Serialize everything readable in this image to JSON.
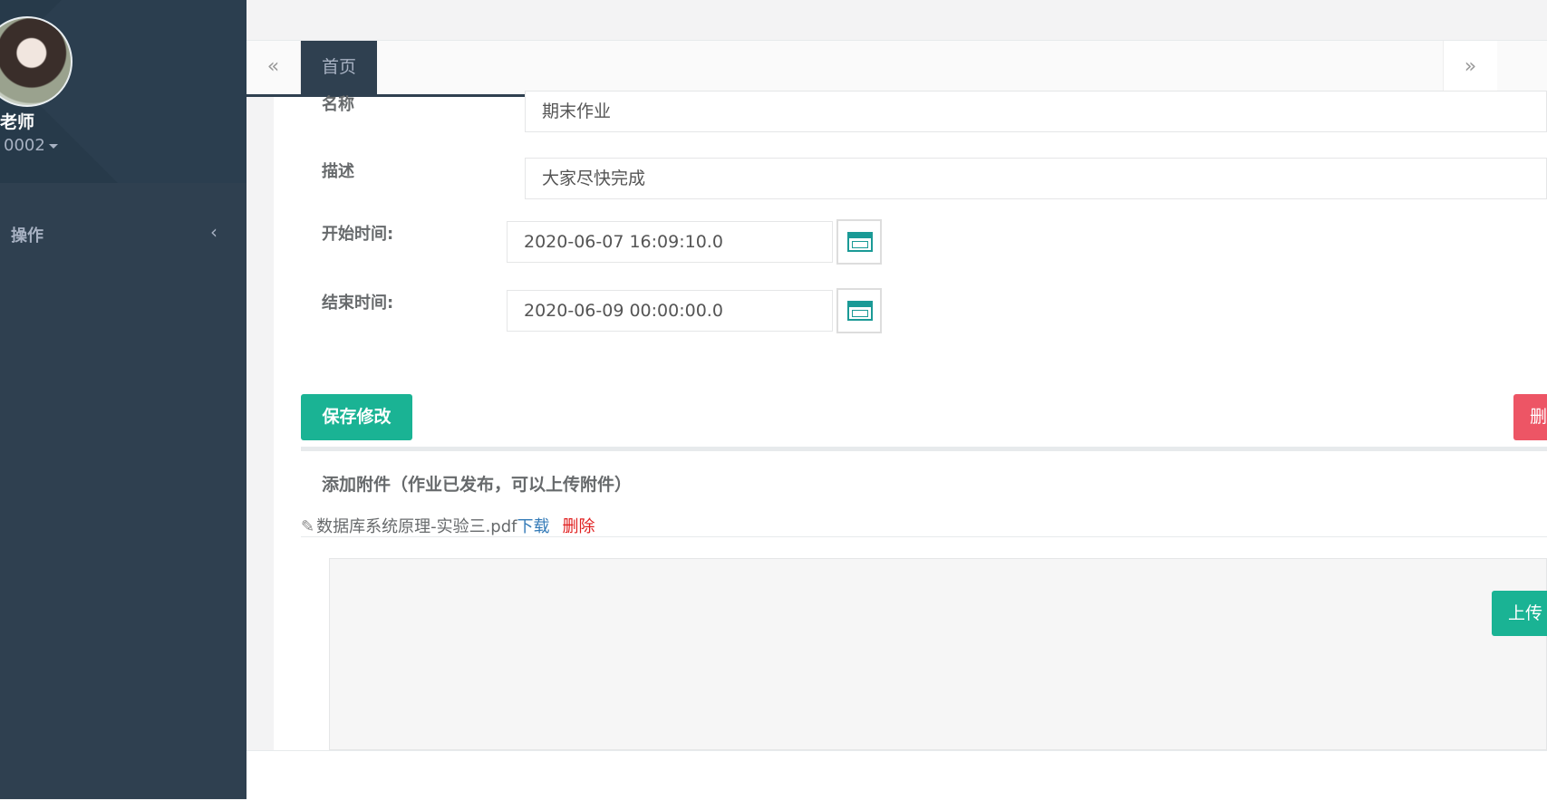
{
  "user": {
    "name": "老师",
    "id": "0002"
  },
  "sidebar": {
    "items": [
      {
        "label": "操作",
        "chevron": "‹"
      }
    ]
  },
  "tabs": {
    "prev": "«",
    "home": "首页",
    "next": "»"
  },
  "form": {
    "name_label": "名称",
    "name_value": "期末作业",
    "desc_label": "描述",
    "desc_value": "大家尽快完成",
    "start_label": "开始时间:",
    "start_value": "2020-06-07 16:09:10.0",
    "end_label": "结束时间:",
    "end_value": "2020-06-09 00:00:00.0"
  },
  "buttons": {
    "save": "保存修改",
    "delete": "删除",
    "upload": "上传"
  },
  "attachments": {
    "title": "添加附件（作业已发布，可以上传附件）",
    "file": {
      "name": "数据库系统原理-实验三.pdf",
      "download": "下载",
      "remove": "删除"
    }
  },
  "icons": {
    "calendar": "calendar-icon",
    "paperclip": "paperclip-icon"
  },
  "colors": {
    "sidebar": "#2f4050",
    "primary": "#1ab394",
    "danger": "#ed5565",
    "link": "#337ab7"
  }
}
